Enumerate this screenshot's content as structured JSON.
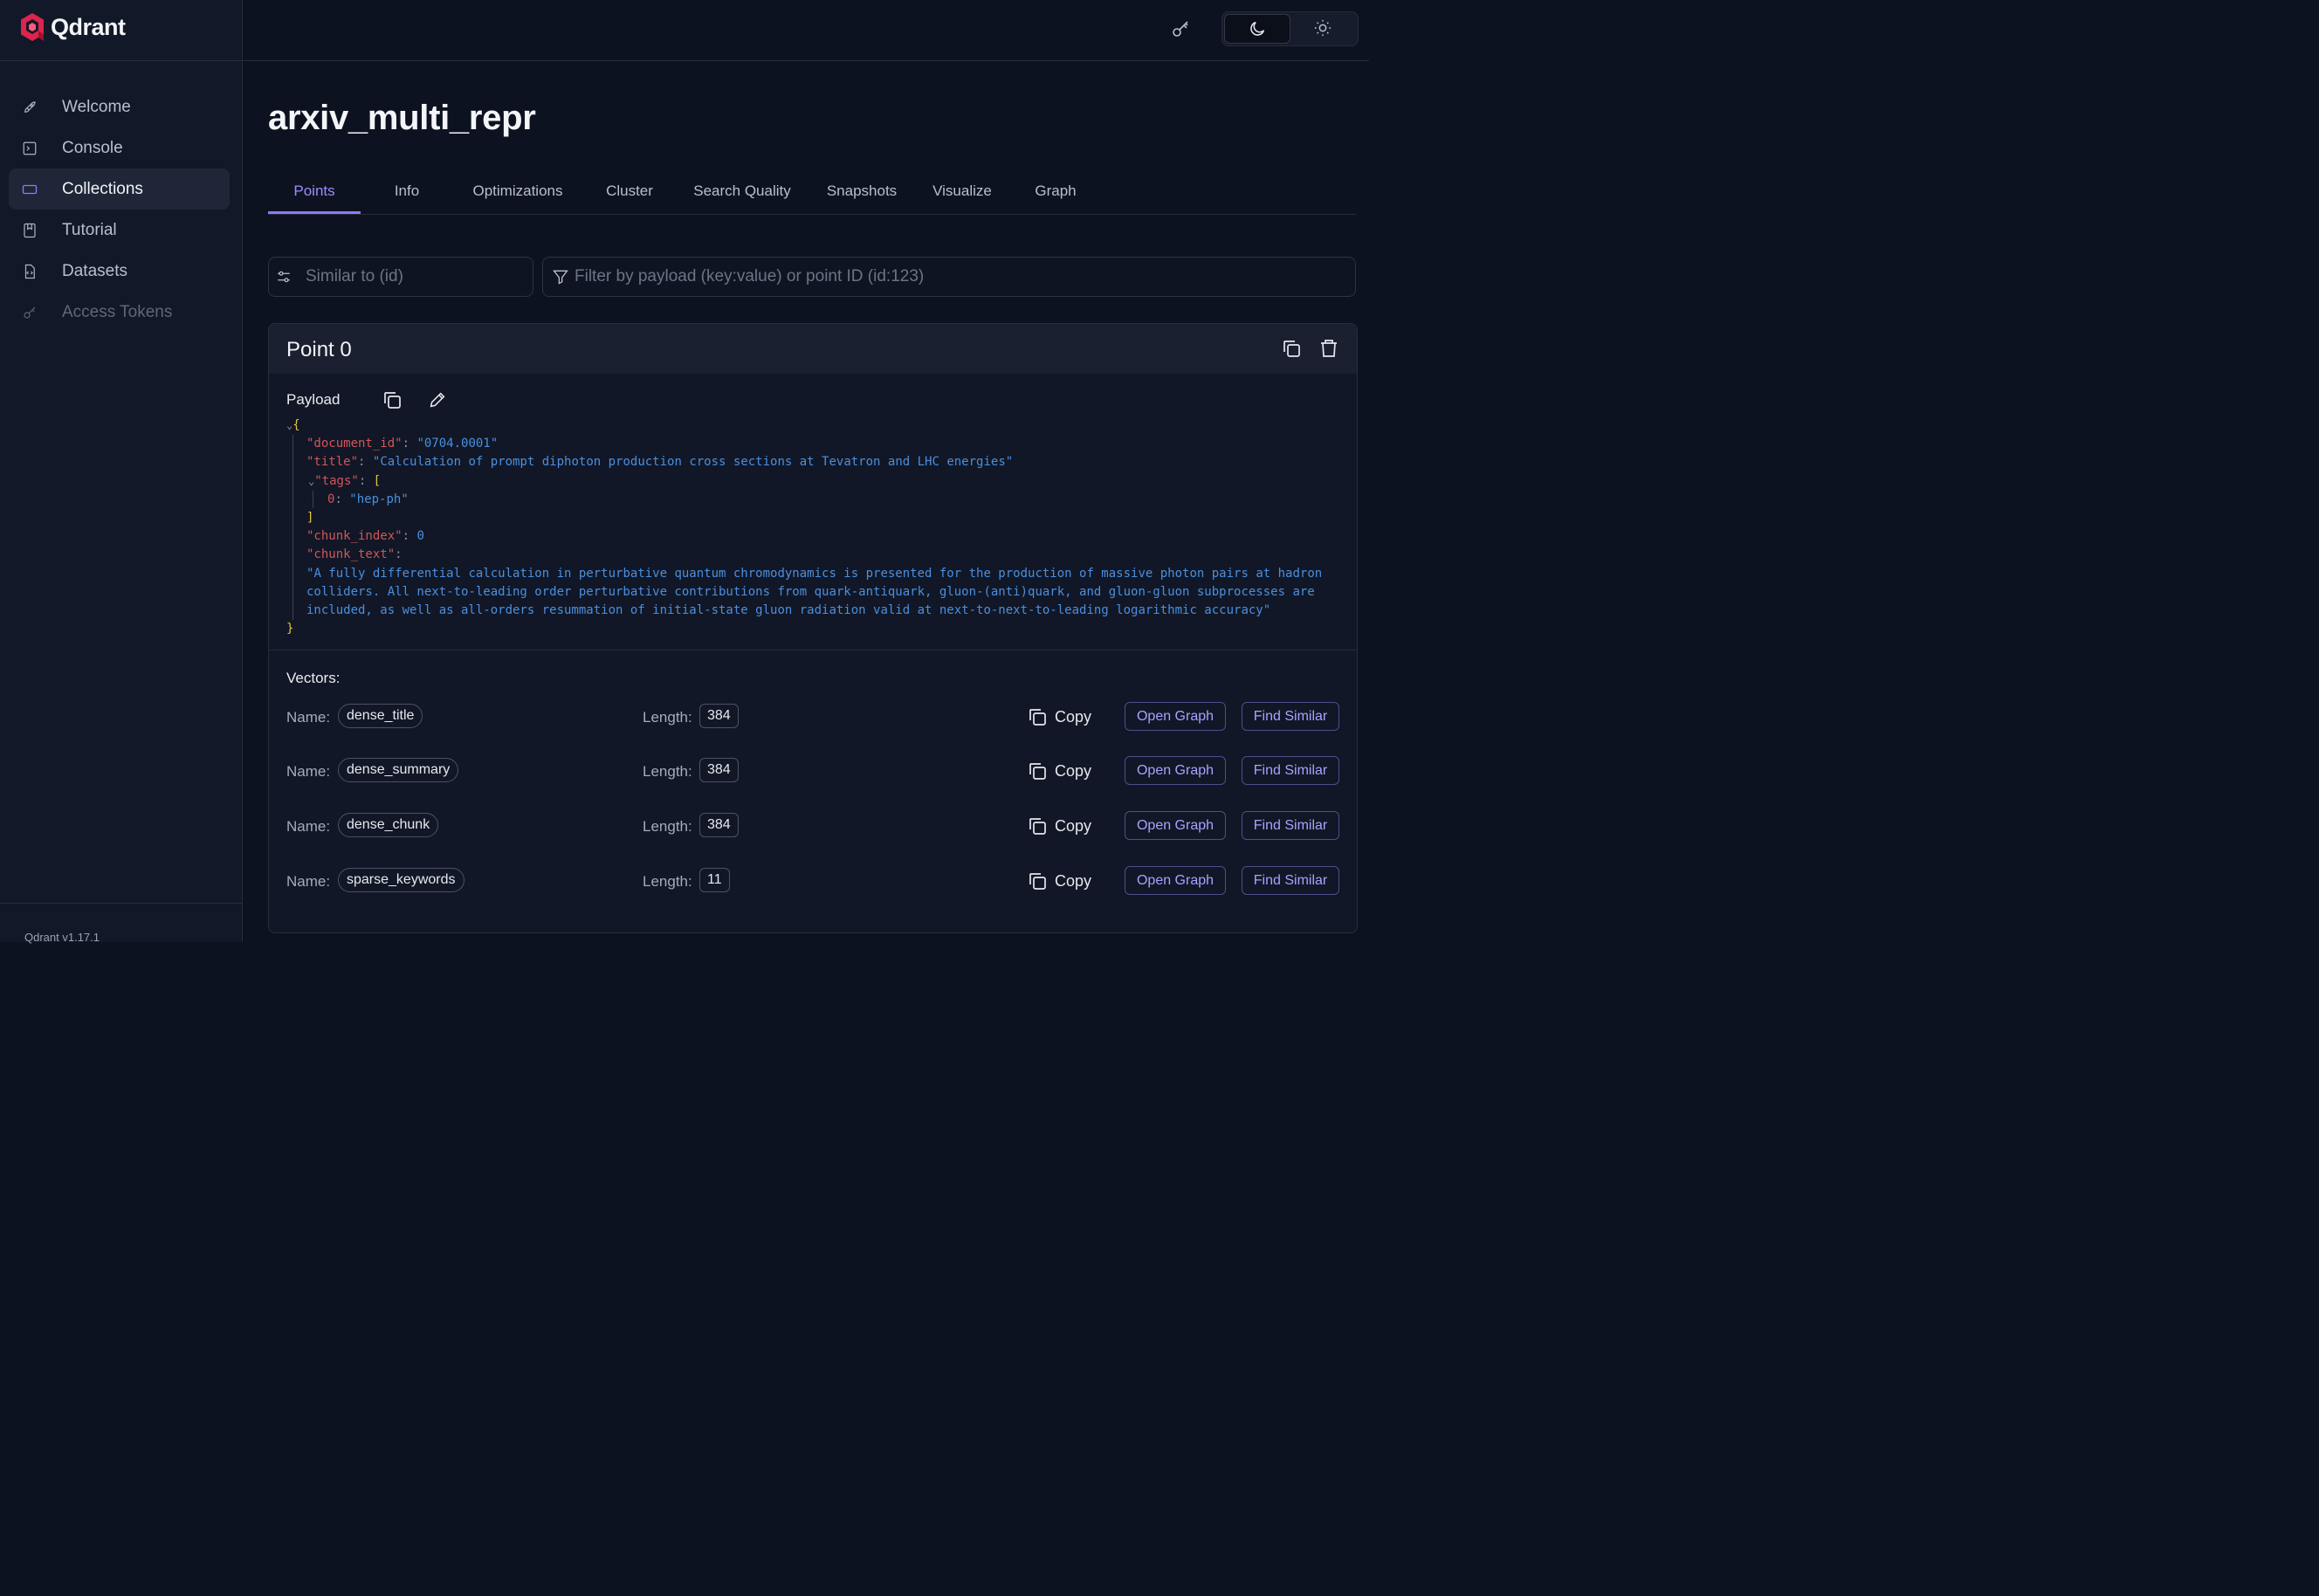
{
  "app": {
    "name": "Qdrant",
    "version": "Qdrant v1.17.1"
  },
  "sidebar": {
    "items": [
      {
        "label": "Welcome",
        "icon": "rocket-icon"
      },
      {
        "label": "Console",
        "icon": "terminal-icon"
      },
      {
        "label": "Collections",
        "icon": "collections-icon",
        "active": true
      },
      {
        "label": "Tutorial",
        "icon": "book-icon"
      },
      {
        "label": "Datasets",
        "icon": "file-code-icon"
      },
      {
        "label": "Access Tokens",
        "icon": "key-icon",
        "disabled": true
      }
    ]
  },
  "header": {
    "theme_selected": "dark"
  },
  "page": {
    "title": "arxiv_multi_repr"
  },
  "tabs": [
    "Points",
    "Info",
    "Optimizations",
    "Cluster",
    "Search Quality",
    "Snapshots",
    "Visualize",
    "Graph"
  ],
  "active_tab": "Points",
  "search": {
    "similar_placeholder": "Similar to (id)",
    "filter_placeholder": "Filter by payload (key:value) or point ID (id:123)"
  },
  "point": {
    "title": "Point 0",
    "payload_label": "Payload",
    "payload": {
      "document_id": "0704.0001",
      "title": "Calculation of prompt diphoton production cross sections at Tevatron and LHC energies",
      "tags": [
        "hep-ph"
      ],
      "chunk_index": 0,
      "chunk_text": "A fully differential calculation in perturbative quantum chromodynamics is presented for the production of massive photon pairs at hadron colliders. All next-to-leading order perturbative contributions from quark-antiquark, gluon-(anti)quark, and gluon-gluon subprocesses are included, as well as all-orders resummation of initial-state gluon radiation valid at next-to-next-to-leading logarithmic accuracy"
    },
    "vectors_label": "Vectors:",
    "name_label": "Name:",
    "length_label": "Length:",
    "copy_label": "Copy",
    "open_graph_label": "Open Graph",
    "find_similar_label": "Find Similar",
    "vectors": [
      {
        "name": "dense_title",
        "length": "384"
      },
      {
        "name": "dense_summary",
        "length": "384"
      },
      {
        "name": "dense_chunk",
        "length": "384"
      },
      {
        "name": "sparse_keywords",
        "length": "11"
      }
    ]
  },
  "colors": {
    "accent": "#8b7cf5",
    "brand": "#dc244c",
    "json_key": "#d2555a",
    "json_string": "#4a8fe0",
    "json_bracket": "#e3c341"
  }
}
